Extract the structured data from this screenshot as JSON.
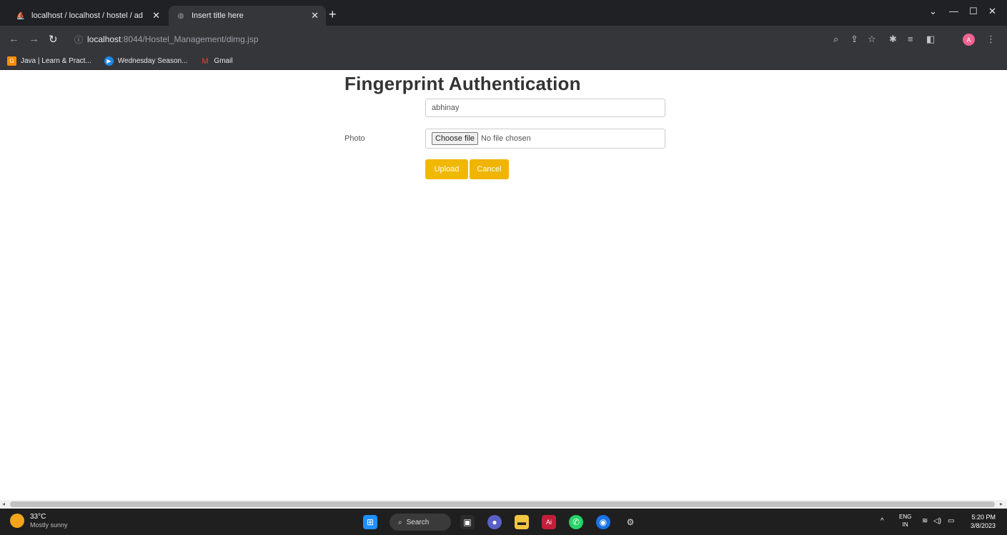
{
  "browser": {
    "tabs": [
      {
        "title": "localhost / localhost / hostel / ad",
        "active": false,
        "icon": "phpmyadmin-icon"
      },
      {
        "title": "Insert title here",
        "active": true,
        "icon": "globe-icon"
      }
    ],
    "address": {
      "host": "localhost",
      "path": ":8044/Hostel_Management/dimg.jsp"
    },
    "bookmarks": [
      {
        "label": "Java | Learn & Pract...",
        "icon": "gfg-icon",
        "color": "#ff8c00"
      },
      {
        "label": "Wednesday Season...",
        "icon": "circle-play-icon",
        "color": "#1e88e5"
      },
      {
        "label": "Gmail",
        "icon": "gmail-icon",
        "color": "#ea4335"
      }
    ],
    "profile_initial": "A"
  },
  "page": {
    "heading": "Fingerprint Authentication",
    "name_value": "abhinay",
    "photo_label": "Photo",
    "file_button": "Choose file",
    "file_status": "No file chosen",
    "upload_label": "Upload",
    "cancel_label": "Cancel",
    "accent": "#f0b800"
  },
  "taskbar": {
    "weather_temp": "33°C",
    "weather_desc": "Mostly sunny",
    "search_label": "Search",
    "lang_top": "ENG",
    "lang_bottom": "IN",
    "time": "5:20 PM",
    "date": "3/8/2023"
  }
}
